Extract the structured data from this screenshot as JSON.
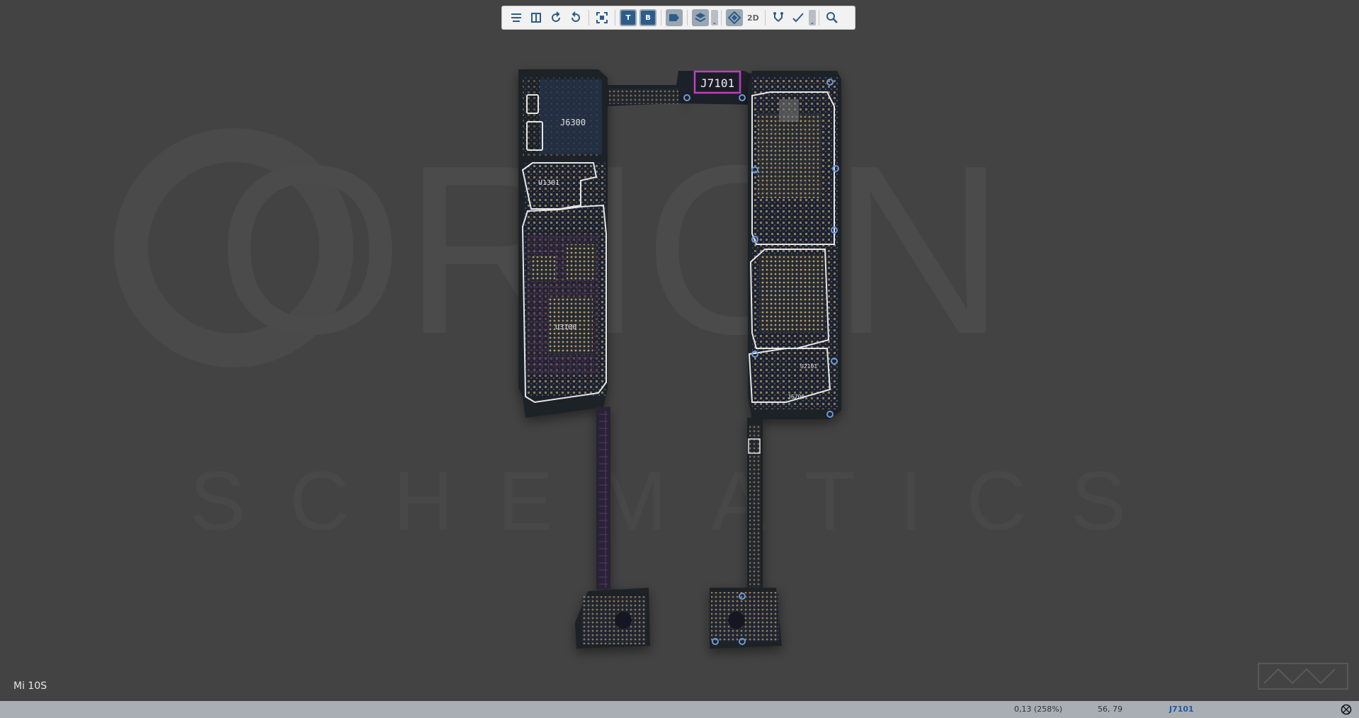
{
  "watermark": {
    "brand": "ORION",
    "subtitle": "SCHEMATICS"
  },
  "toolbar": {
    "buttons": [
      {
        "name": "flip-horizontal-icon"
      },
      {
        "name": "flip-vertical-icon"
      },
      {
        "name": "rotate-left-icon"
      },
      {
        "name": "rotate-right-icon"
      },
      {
        "name": "fit-screen-icon"
      },
      {
        "name": "top-side-button",
        "label": "T"
      },
      {
        "name": "bottom-side-button",
        "label": "B"
      },
      {
        "name": "label-tag-icon"
      },
      {
        "name": "layers-icon"
      },
      {
        "name": "component-view-icon"
      },
      {
        "name": "net-trace-icon"
      },
      {
        "name": "measure-icon"
      },
      {
        "name": "search-icon"
      }
    ],
    "view_mode_label": "2D"
  },
  "board": {
    "labels": {
      "j6300": "J6300",
      "u1301": "U1301",
      "u3100": "U3100",
      "j7101": "J7101",
      "j6700": "J6700",
      "u2101": "U2101"
    },
    "accent_highlight": "#c040c0",
    "outline_color": "#e8e8e8"
  },
  "model": {
    "name": "Mi 10S"
  },
  "statusbar": {
    "zoom": "0,13 (258%)",
    "coords": "56, 79",
    "selected_part": "J7101"
  },
  "colors": {
    "background": "#434343",
    "pcb": "#1d2128",
    "pads": "#c8b27a",
    "statusbar": "#a9aeb4"
  }
}
